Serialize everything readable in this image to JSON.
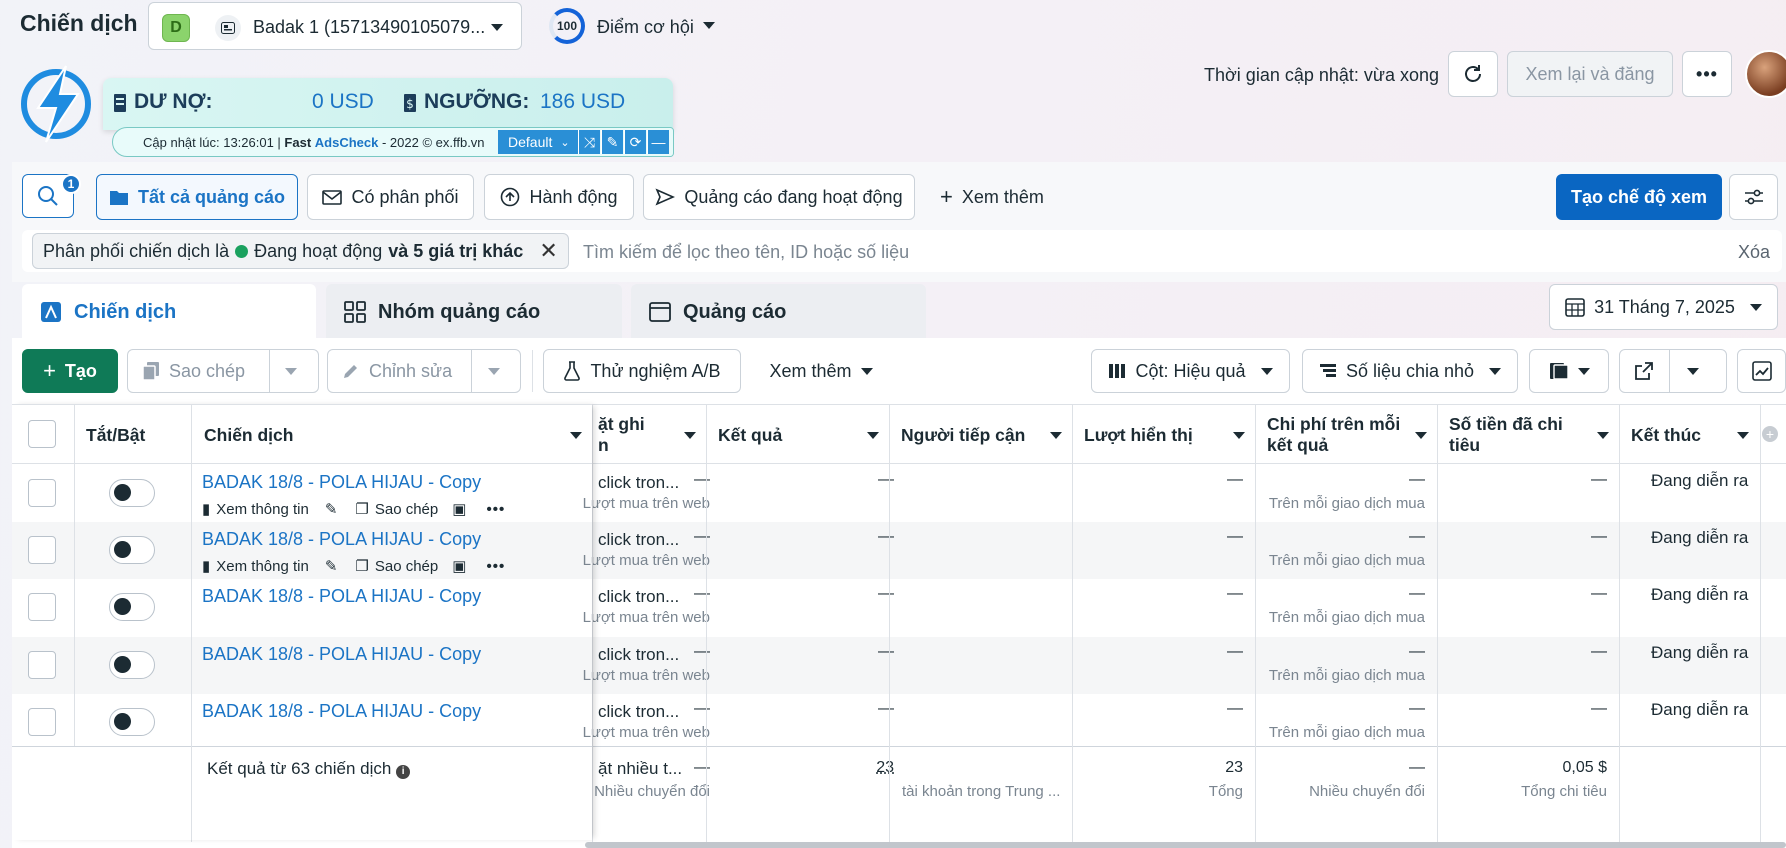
{
  "header": {
    "title": "Chiến dịch",
    "account_badge": "D",
    "account_name": "Badak 1 (15713490105079...",
    "opportunity_score": "100",
    "opportunity_label": "Điểm cơ hội",
    "update_time": "Thời gian cập nhật: vừa xong",
    "review_button": "Xem lại và đăng",
    "more": "•••"
  },
  "adscheck": {
    "debt_label": "DƯ NỢ:",
    "debt_value": "0 USD",
    "threshold_label": "NGƯỠNG:",
    "threshold_value": "186 USD",
    "status_prefix": "Cập nhật lúc: 13:26:01 | ",
    "brand": "Fast",
    "brand2": "AdsCheck",
    "status_suffix": " - 2022 © ex.ffb.vn",
    "profile": "Default"
  },
  "filters": {
    "search_badge": "1",
    "all_ads": "Tất cả quảng cáo",
    "has_delivery": "Có phân phối",
    "actions": "Hành động",
    "active_ads": "Quảng cáo đang hoạt động",
    "see_more": "Xem thêm",
    "create_view": "Tạo chế độ xem"
  },
  "filter_chip": {
    "prefix": "Phân phối chiến dịch là",
    "status": "Đang hoạt động",
    "suffix": "và 5 giá trị khác"
  },
  "search_placeholder": "Tìm kiếm để lọc theo tên, ID hoặc số liệu",
  "clear_label": "Xóa",
  "tabs": {
    "campaigns": "Chiến dịch",
    "adsets": "Nhóm quảng cáo",
    "ads": "Quảng cáo"
  },
  "date_range": "31 Tháng 7, 2025",
  "toolbar": {
    "create": "Tạo",
    "copy": "Sao chép",
    "edit": "Chỉnh sửa",
    "ab_test": "Thử nghiệm A/B",
    "see_more": "Xem thêm",
    "columns": "Cột: Hiệu quả",
    "breakdown": "Số liệu chia nhỏ"
  },
  "table": {
    "headers": {
      "toggle": "Tắt/Bật",
      "campaign": "Chiến dịch",
      "attribution_1": "ặt ghi",
      "attribution_2": "n",
      "results": "Kết quả",
      "reach": "Người tiếp cận",
      "impressions": "Lượt hiển thị",
      "cost_1": "Chi phí trên mỗi",
      "cost_2": "kết quả",
      "spent_1": "Số tiền đã chi",
      "spent_2": "tiêu",
      "ends": "Kết thúc"
    },
    "rows": [
      {
        "name": "BADAK 18/8 - POLA HIJAU - Copy",
        "attribution": "click tron...",
        "result": "—",
        "result_sub": "Lượt mua trên web",
        "reach": "—",
        "impressions": "—",
        "cost": "—",
        "cost_sub": "Trên mỗi giao dịch mua",
        "spent": "—",
        "end": "Đang diễn ra",
        "show_actions": true
      },
      {
        "name": "BADAK 18/8 - POLA HIJAU - Copy",
        "attribution": "click tron...",
        "result": "—",
        "result_sub": "Lượt mua trên web",
        "reach": "—",
        "impressions": "—",
        "cost": "—",
        "cost_sub": "Trên mỗi giao dịch mua",
        "spent": "—",
        "end": "Đang diễn ra",
        "show_actions": true
      },
      {
        "name": "BADAK 18/8 - POLA HIJAU - Copy",
        "attribution": "click tron...",
        "result": "—",
        "result_sub": "Lượt mua trên web",
        "reach": "—",
        "impressions": "—",
        "cost": "—",
        "cost_sub": "Trên mỗi giao dịch mua",
        "spent": "—",
        "end": "Đang diễn ra",
        "show_actions": false
      },
      {
        "name": "BADAK 18/8 - POLA HIJAU - Copy",
        "attribution": "click tron...",
        "result": "—",
        "result_sub": "Lượt mua trên web",
        "reach": "—",
        "impressions": "—",
        "cost": "—",
        "cost_sub": "Trên mỗi giao dịch mua",
        "spent": "—",
        "end": "Đang diễn ra",
        "show_actions": false
      },
      {
        "name": "BADAK 18/8 - POLA HIJAU - Copy",
        "attribution": "click tron...",
        "result": "—",
        "result_sub": "Lượt mua trên web",
        "reach": "—",
        "impressions": "—",
        "cost": "—",
        "cost_sub": "Trên mỗi giao dịch mua",
        "spent": "—",
        "end": "Đang diễn ra",
        "show_actions": false
      }
    ],
    "row_actions": {
      "view": "Xem thông tin",
      "copy": "Sao chép"
    },
    "totals": {
      "label": "Kết quả từ 63 chiến dịch",
      "attribution": "ặt nhiều t...",
      "result": "—",
      "result_sub": "Nhiều chuyển đổi",
      "reach": "23",
      "reach_sub": "tài khoản trong Trung ...",
      "impressions": "23",
      "impressions_sub": "Tổng",
      "cost": "—",
      "cost_sub": "Nhiều chuyển đổi",
      "spent": "0,05 $",
      "spent_sub": "Tổng chi tiêu"
    }
  },
  "colors": {
    "primary": "#1b74c5",
    "create": "#0f7a57",
    "active": "#1aa15e"
  }
}
